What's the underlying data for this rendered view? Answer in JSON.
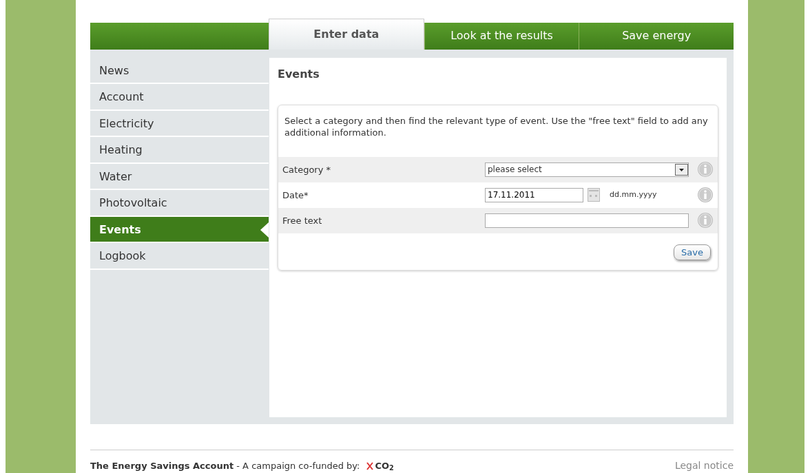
{
  "tabs": [
    {
      "label": "Enter data",
      "selected": true
    },
    {
      "label": "Look at the results",
      "selected": false
    },
    {
      "label": "Save energy",
      "selected": false
    }
  ],
  "sidebar": {
    "items": [
      {
        "label": "News",
        "selected": false
      },
      {
        "label": "Account",
        "selected": false
      },
      {
        "label": "Electricity",
        "selected": false
      },
      {
        "label": "Heating",
        "selected": false
      },
      {
        "label": "Water",
        "selected": false
      },
      {
        "label": "Photovoltaic",
        "selected": false
      },
      {
        "label": "Events",
        "selected": true
      },
      {
        "label": "Logbook",
        "selected": false
      }
    ]
  },
  "main": {
    "title": "Events",
    "intro": "Select a category and then find the relevant type of event. Use the \"free text\" field to add any additional information.",
    "fields": [
      {
        "kind": "select",
        "label": "Category *",
        "value": "please select"
      },
      {
        "kind": "date",
        "label": "Date*",
        "value": "17.11.2011",
        "hint": "dd.mm.yyyy"
      },
      {
        "kind": "text",
        "label": "Free text"
      }
    ],
    "save_button": "Save"
  },
  "footer": {
    "title": "The Energy Savings Account",
    "text": " - A campaign co-funded by:",
    "logo": "CO$_{2}$",
    "legal": "Legal notice"
  }
}
